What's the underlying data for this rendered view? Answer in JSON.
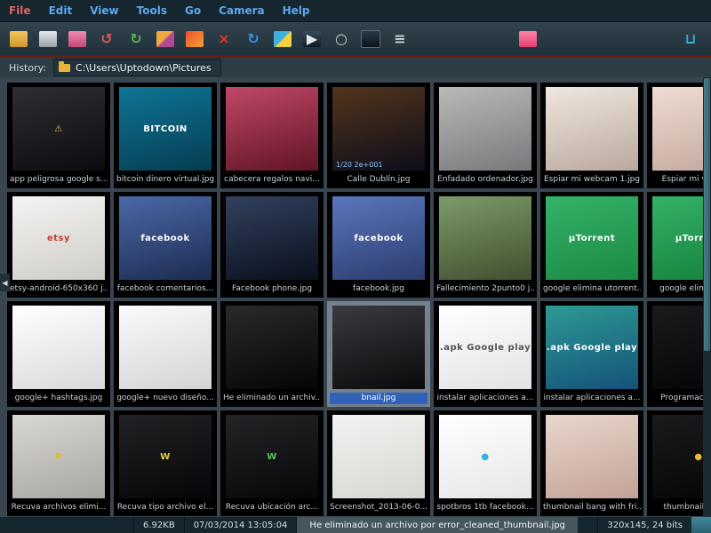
{
  "menu": {
    "items": [
      {
        "label": "File",
        "color": "#e06464"
      },
      {
        "label": "Edit",
        "color": "#5ea6ee"
      },
      {
        "label": "View",
        "color": "#5ea6ee"
      },
      {
        "label": "Tools",
        "color": "#5ea6ee"
      },
      {
        "label": "Go",
        "color": "#5ea6ee"
      },
      {
        "label": "Camera",
        "color": "#5ea6ee"
      },
      {
        "label": "Help",
        "color": "#5ea6ee"
      }
    ]
  },
  "toolbar": {
    "buttons": [
      {
        "name": "open-folder-button",
        "glyph": "",
        "bg": "linear-gradient(#f2c75c,#cd9630)",
        "fg": "#ffffff"
      },
      {
        "name": "print-button",
        "glyph": "",
        "bg": "linear-gradient(#e8e8ee,#9aa0a8)",
        "fg": "#333333"
      },
      {
        "name": "save-as-button",
        "glyph": "",
        "bg": "linear-gradient(#f08ab0,#c04878)",
        "fg": "#ffffff"
      },
      {
        "name": "undo-button",
        "glyph": "↺",
        "bg": "",
        "fg": "#e85555"
      },
      {
        "name": "redo-button",
        "glyph": "↻",
        "bg": "",
        "fg": "#52b852"
      },
      {
        "name": "photos-button",
        "glyph": "",
        "bg": "linear-gradient(135deg,#f0a840 45%,#b04898 55%)",
        "fg": "#ffffff"
      },
      {
        "name": "effects-button",
        "glyph": "",
        "bg": "linear-gradient(135deg,#f05030,#f0a030)",
        "fg": "#ffffff"
      },
      {
        "name": "delete-button",
        "glyph": "×",
        "bg": "",
        "fg": "#e83030"
      },
      {
        "name": "refresh-button",
        "glyph": "↻",
        "bg": "",
        "fg": "#3a90e8"
      },
      {
        "name": "copy-button",
        "glyph": "",
        "bg": "linear-gradient(135deg,#40b0e0 50%,#f0d040 50%)",
        "fg": "#ffffff"
      },
      {
        "name": "slideshow-button",
        "glyph": "▶",
        "bg": "linear-gradient(#3a4a5a,#101a24)",
        "fg": "#e0e6ea"
      },
      {
        "name": "zoom-button",
        "glyph": "○",
        "bg": "",
        "fg": "#c8d0d6"
      },
      {
        "name": "fullscreen-button",
        "glyph": "",
        "bg": "linear-gradient(#2a3a46,#0a141c)",
        "fg": "#ffffff",
        "border": "1px solid #5a6a74"
      },
      {
        "name": "settings-button",
        "glyph": "≡",
        "bg": "",
        "fg": "#c8d0d6"
      },
      {
        "name": "uptodown-badge-button",
        "glyph": "",
        "bg": "linear-gradient(#ff85a8,#e04070)",
        "fg": "#ffffff"
      },
      {
        "name": "cart-button",
        "glyph": "⊔",
        "bg": "",
        "fg": "#38b0d8"
      }
    ]
  },
  "history": {
    "label": "History:",
    "path": "C:\\Users\\Uptodown\\Pictures"
  },
  "grid": {
    "items": [
      {
        "label": "app peligrosa google s...",
        "c1": "#2e2e33",
        "c2": "#0c0c10",
        "ov": "⚠",
        "ovc": "#e8c84a"
      },
      {
        "label": "bitcoin dinero virtual.jpg",
        "c1": "#0f7596",
        "c2": "#063d52",
        "ov": "BITCOIN",
        "ovc": "#ffffff"
      },
      {
        "label": "cabecera regalos navi...",
        "c1": "#c04868",
        "c2": "#611426"
      },
      {
        "label": "Calle Dublín.jpg",
        "c1": "#53351d",
        "c2": "#0d0d1a",
        "exif": "1/20  2e+001"
      },
      {
        "label": "Enfadado ordenador.jpg",
        "c1": "#b9b9b6",
        "c2": "#77797b"
      },
      {
        "label": "Espiar mi webcam 1.jpg",
        "c1": "#efe6df",
        "c2": "#baa89e"
      },
      {
        "label": "Espiar mi webcam",
        "c1": "#efdcd2",
        "c2": "#c3a79b"
      },
      {
        "label": "etsy-android-650x360 j...",
        "c1": "#f4f3f1",
        "c2": "#cfcdc9",
        "ov": "etsy",
        "ovc": "#c04030"
      },
      {
        "label": "facebook comentarios...",
        "c1": "#4b69a8",
        "c2": "#1d2c50",
        "ov": "facebook",
        "ovc": "#ffffff"
      },
      {
        "label": "Facebook phone.jpg",
        "c1": "#33415f",
        "c2": "#0a0f1c"
      },
      {
        "label": "facebook.jpg",
        "c1": "#5a77bd",
        "c2": "#2c3c6e",
        "ov": "facebook",
        "ovc": "#ffffff"
      },
      {
        "label": "Fallecimiento 2punto0 j...",
        "c1": "#7d9a6a",
        "c2": "#41502f"
      },
      {
        "label": "google elimina utorrent...",
        "c1": "#35b269",
        "c2": "#1b8a44",
        "ov": "µTorrent",
        "ovc": "#ffffff"
      },
      {
        "label": "google elimina utor",
        "c1": "#35b269",
        "c2": "#15803c",
        "ov": "µTorrent",
        "ovc": "#ffffff"
      },
      {
        "label": "google+ hashtags.jpg",
        "c1": "#ffffff",
        "c2": "#d9d9d9"
      },
      {
        "label": "google+ nuevo diseño...",
        "c1": "#fafafa",
        "c2": "#d4d4d4"
      },
      {
        "label": "He eliminado un archiv...",
        "c1": "#2a2a2e",
        "c2": "#050507"
      },
      {
        "label": "bnail.jpg",
        "c1": "#3a3a40",
        "c2": "#0a0a0c",
        "sel": true
      },
      {
        "label": "instalar aplicaciones a...",
        "c1": "#ffffff",
        "c2": "#e2e2e2",
        "ov": ".apk Google play",
        "ovc": "#555555"
      },
      {
        "label": "instalar aplicaciones a...",
        "c1": "#2e9a94",
        "c2": "#14527a",
        "ov": ".apk Google play",
        "ovc": "#ffffff"
      },
      {
        "label": "Programacion para",
        "c1": "#1b1b1f",
        "c2": "#040406"
      },
      {
        "label": "Recuva archivos elimi...",
        "c1": "#d9d7d2",
        "c2": "#a8a6a0",
        "ov": "P",
        "ovc": "#d8c020"
      },
      {
        "label": "Recuva tipo archivo el...",
        "c1": "#222226",
        "c2": "#060608",
        "ov": "W",
        "ovc": "#e8d040"
      },
      {
        "label": "Recuva ubicación arc...",
        "c1": "#242428",
        "c2": "#070709",
        "ov": "W",
        "ovc": "#58c858"
      },
      {
        "label": "Screenshot_2013-06-0...",
        "c1": "#f2f2f0",
        "c2": "#d6d6d2"
      },
      {
        "label": "spotbros 1tb facebook...",
        "c1": "#ffffff",
        "c2": "#e6e6e6",
        "ov": "●",
        "ovc": "#3ab0e0"
      },
      {
        "label": "thumbnail bang with fri...",
        "c1": "#e9d6cc",
        "c2": "#c2a296"
      },
      {
        "label": "thumbnail bitcoin",
        "c1": "#1b1b1d",
        "c2": "#050505",
        "ov": "●",
        "ovc": "#e8b830"
      }
    ]
  },
  "status": {
    "size": "6.92KB",
    "datetime": "07/03/2014 13:05:04",
    "message": "He eliminado un archivo por error_cleaned_thumbnail.jpg",
    "info": "320x145, 24 bits"
  }
}
